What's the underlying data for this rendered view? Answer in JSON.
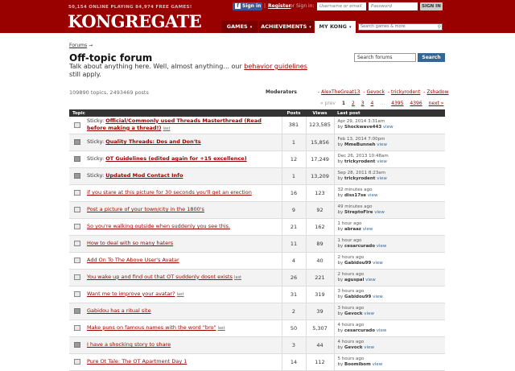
{
  "header": {
    "stats": "50,154 ONLINE PLAYING 84,974 FREE GAMES!",
    "logo": "KONGREGATE",
    "fb_label": "Sign in",
    "register": "Register",
    "or_sign_in": "or Sign in:",
    "username_placeholder": "Username or email",
    "password_placeholder": "Password",
    "sign_in_button": "SIGN IN",
    "nav": {
      "games": "GAMES",
      "achievements": "ACHIEVEMENTS",
      "my_kong": "MY KONG"
    },
    "search_placeholder": "Search games & more"
  },
  "breadcrumb": {
    "forums": "Forums",
    "arrow": "→"
  },
  "page": {
    "title": "Off-topic forum",
    "desc_prefix": "Talk about anything here. Well, almost anything... our ",
    "desc_link": "behavior guidelines",
    "desc_suffix": "still apply.",
    "search_value": "Search forums",
    "search_button": "Search",
    "counts": "109890 topics, 2493469 posts",
    "moderators_label": "Moderators",
    "moderators": [
      "AlexTheGreat13",
      "Gevock",
      "trickyrodent",
      "Zshadow"
    ]
  },
  "pagination": {
    "prev": "« prev",
    "pages": [
      "1",
      "2",
      "3",
      "4",
      "…",
      "4395",
      "4396"
    ],
    "next": "next »"
  },
  "table": {
    "headers": {
      "topic": "Topic",
      "posts": "Posts",
      "views": "Views",
      "last": "Last post"
    },
    "by": "by",
    "view": "view",
    "last_label": "last",
    "rows": [
      {
        "sticky": "Sticky:",
        "title": "Official/Commonly used Threads Masterthread (Read before making a thread!)",
        "bold": true,
        "last_link": true,
        "posts": "381",
        "views": "123,585",
        "date": "Apr 29, 2014 3:31am",
        "user": "Shockwave443",
        "locked": false
      },
      {
        "sticky": "Sticky:",
        "title": "Quality Threads: Dos and Don'ts",
        "bold": true,
        "last_link": false,
        "posts": "1",
        "views": "15,856",
        "date": "Feb 13, 2014 7:00pm",
        "user": "MmeBunneh",
        "locked": true
      },
      {
        "sticky": "Sticky:",
        "title": "OT Guidelines (edited again for +15 excellence)",
        "bold": true,
        "last_link": false,
        "posts": "12",
        "views": "17,249",
        "date": "Dec 26, 2013 10:48am",
        "user": "trickyrodent",
        "locked": true
      },
      {
        "sticky": "Sticky:",
        "title": "Updated Mod Contact Info",
        "bold": true,
        "last_link": false,
        "posts": "1",
        "views": "13,209",
        "date": "Sep 28, 2011 8:23am",
        "user": "trickyrodent",
        "locked": true
      },
      {
        "sticky": "",
        "title": "if you stare at this picture for 30 seconds you'll get an erection",
        "bold": false,
        "last_link": false,
        "posts": "16",
        "views": "123",
        "date": "32 minutes ago",
        "user": "diss17se",
        "locked": false
      },
      {
        "sticky": "",
        "title": "Post a picture of your town/city in the 1800's",
        "bold": false,
        "last_link": false,
        "posts": "9",
        "views": "92",
        "date": "49 minutes ago",
        "user": "StreptoFire",
        "locked": false
      },
      {
        "sticky": "",
        "title": "So you're walking outside when suddenly you see this.",
        "bold": false,
        "last_link": false,
        "posts": "21",
        "views": "162",
        "date": "1 hour ago",
        "user": "abraaz",
        "locked": false
      },
      {
        "sticky": "",
        "title": "How to deal with so many haters",
        "bold": false,
        "last_link": false,
        "posts": "11",
        "views": "89",
        "date": "1 hour ago",
        "user": "cesarcurado",
        "locked": false
      },
      {
        "sticky": "",
        "title": "Add On To The Above User's Avatar",
        "bold": false,
        "last_link": false,
        "posts": "4",
        "views": "40",
        "date": "2 hours ago",
        "user": "Gabidou99",
        "locked": false
      },
      {
        "sticky": "",
        "title": "You wake up and find out that OT suddenly dosnt exists",
        "bold": false,
        "last_link": true,
        "posts": "26",
        "views": "221",
        "date": "2 hours ago",
        "user": "aguspal",
        "locked": false
      },
      {
        "sticky": "",
        "title": "Want me to improve your avatar?",
        "bold": false,
        "last_link": true,
        "posts": "31",
        "views": "319",
        "date": "3 hours ago",
        "user": "Gabidou99",
        "locked": false
      },
      {
        "sticky": "",
        "title": "Gabidou has a ritual site",
        "bold": false,
        "last_link": false,
        "posts": "2",
        "views": "39",
        "date": "3 hours ago",
        "user": "Gevock",
        "locked": true
      },
      {
        "sticky": "",
        "title": "Make puns on famous names with the word \"bro\"",
        "bold": false,
        "last_link": true,
        "posts": "50",
        "views": "5,307",
        "date": "4 hours ago",
        "user": "cesarcurado",
        "locked": false
      },
      {
        "sticky": "",
        "title": "I have a shocking story to share",
        "bold": false,
        "last_link": false,
        "posts": "3",
        "views": "44",
        "date": "4 hours ago",
        "user": "Gevock",
        "locked": true
      },
      {
        "sticky": "",
        "title": "Pure Ot Tale: The OT Apartment Day 1",
        "bold": false,
        "last_link": false,
        "posts": "14",
        "views": "112",
        "date": "5 hours ago",
        "user": "Boomibom",
        "locked": false
      }
    ]
  }
}
